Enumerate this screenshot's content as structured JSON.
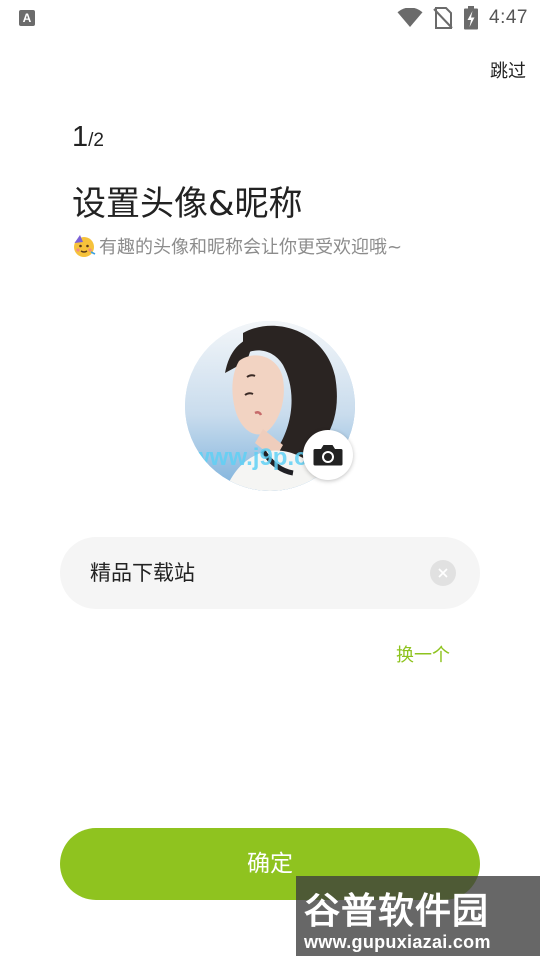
{
  "status_bar": {
    "app_icon_letter": "A",
    "time": "4:47",
    "icons": [
      "wifi-icon",
      "no-sim-icon",
      "battery-charging-icon"
    ]
  },
  "header": {
    "skip_label": "跳过"
  },
  "step": {
    "current": "1",
    "separator": "/",
    "total": "2"
  },
  "title": "设置头像&昵称",
  "subtitle": {
    "emoji_icon": "party-face-icon",
    "text": "有趣的头像和昵称会让你更受欢迎哦~"
  },
  "avatar": {
    "overlay_text": "www.j9p.c",
    "camera_icon": "camera-icon"
  },
  "nickname": {
    "value": "精品下载站",
    "clear_icon": "clear-icon"
  },
  "change_label": "换一个",
  "confirm_label": "确定",
  "watermark": {
    "main": "谷普软件园",
    "sub": "www.gupuxiazai.com"
  },
  "colors": {
    "accent": "#8fc31f",
    "change_link": "#8ec31e",
    "subtitle": "#8c8c8c",
    "input_bg": "#f5f5f5"
  }
}
